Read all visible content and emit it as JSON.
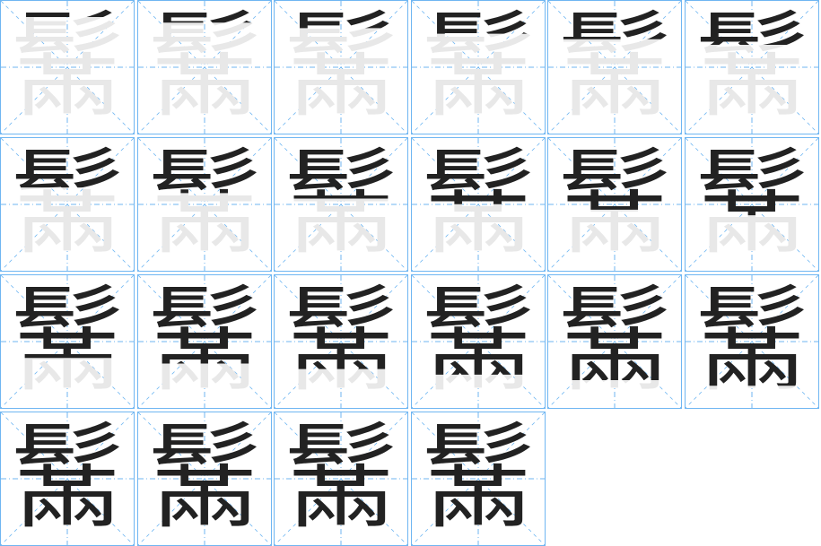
{
  "character": "鬗",
  "total_strokes": 22,
  "colors": {
    "grid": "#6fb6f2",
    "ghost": "#e8e8e8",
    "ink": "#222222",
    "current_stroke": "#ff4d4d"
  },
  "steps": [
    1,
    2,
    3,
    4,
    5,
    6,
    7,
    8,
    9,
    10,
    11,
    12,
    13,
    14,
    15,
    16,
    17,
    18,
    19,
    20,
    21,
    22
  ]
}
